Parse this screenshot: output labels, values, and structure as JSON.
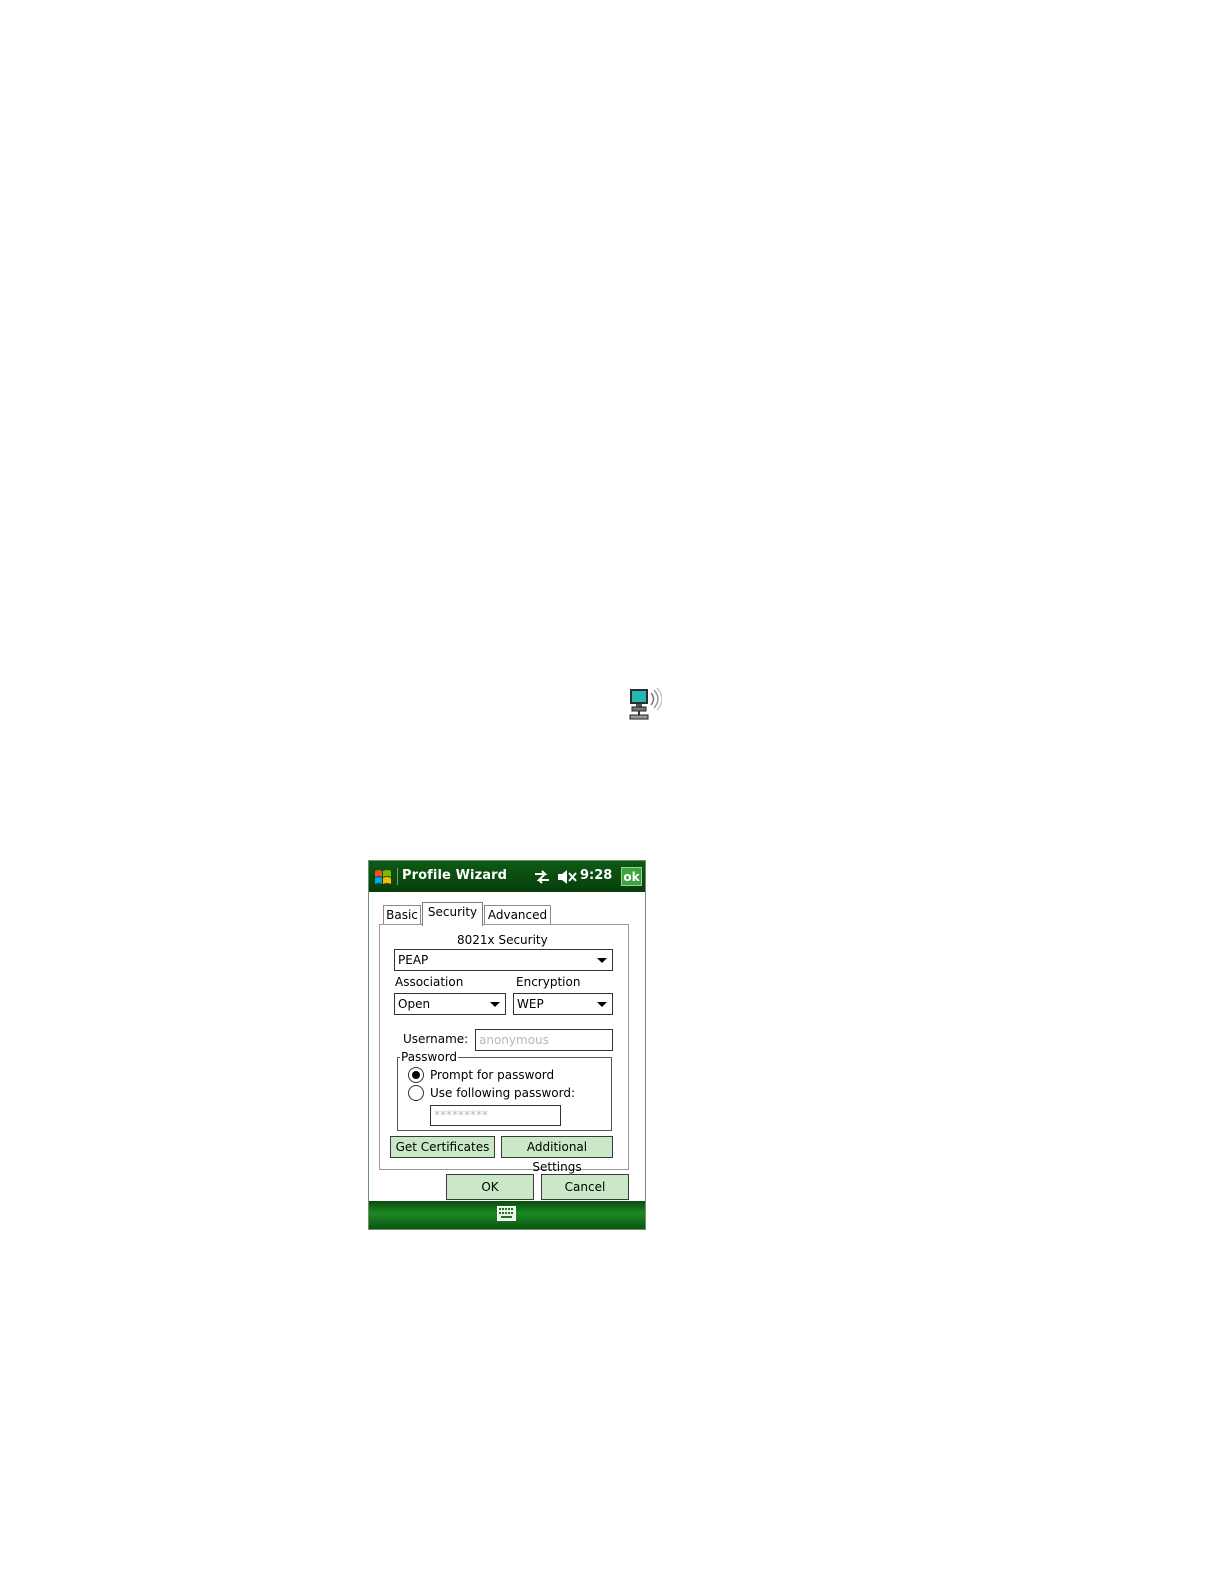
{
  "device": {
    "title": "Profile Wizard",
    "clock": "9:28",
    "ok_badge": "ok",
    "icons": [
      "windows-start-icon",
      "sync-icon",
      "volume-muted-icon",
      "keyboard-icon"
    ]
  },
  "tabs": [
    {
      "label": "Basic",
      "selected": false
    },
    {
      "label": "Security",
      "selected": true
    },
    {
      "label": "Advanced",
      "selected": false
    }
  ],
  "security": {
    "security_label": "8021x Security",
    "security_value": "PEAP",
    "association_label": "Association",
    "association_value": "Open",
    "encryption_label": "Encryption",
    "encryption_value": "WEP",
    "username_label": "Username:",
    "username_value": "anonymous",
    "password_group_label": "Password",
    "radio_prompt_label": "Prompt for password",
    "radio_prompt_selected": true,
    "radio_use_label": "Use following password:",
    "password_value": "*********",
    "get_certificates_label": "Get Certificates",
    "additional_settings_label": "Additional Settings"
  },
  "dialog_buttons": {
    "ok_label": "OK",
    "cancel_label": "Cancel"
  },
  "page_icon": "network-computer-icon",
  "colors": {
    "title_bar": "#0a4a10",
    "ok_badge": "#3fa43f",
    "button_fill": "#c8e8c8",
    "bottom_bar": "#1c8a22"
  }
}
